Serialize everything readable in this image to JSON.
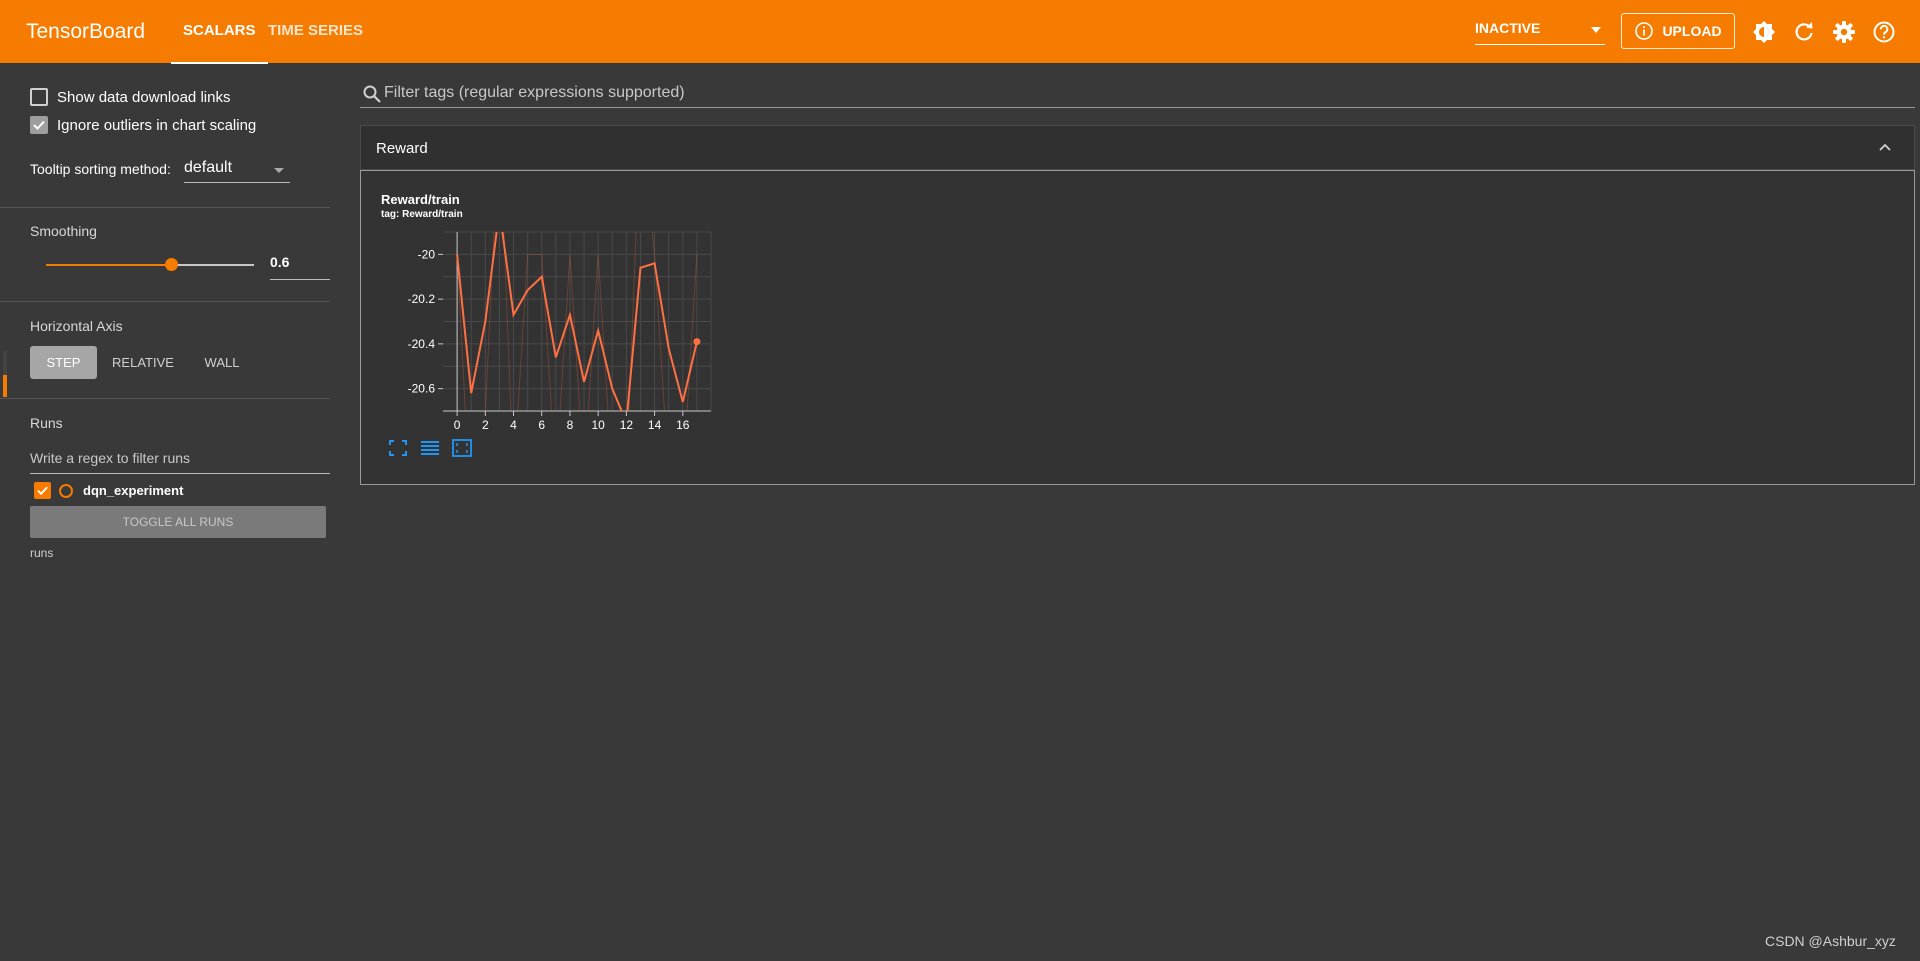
{
  "header": {
    "brand": "TensorBoard",
    "tabs": [
      {
        "label": "SCALARS"
      },
      {
        "label": "TIME SERIES"
      }
    ],
    "status": "INACTIVE",
    "upload_label": "UPLOAD",
    "accent_color": "#f57c00"
  },
  "sidebar": {
    "show_download_links": {
      "label": "Show data download links",
      "checked": false
    },
    "ignore_outliers": {
      "label": "Ignore outliers in chart scaling",
      "checked": true
    },
    "tooltip_sorting": {
      "label": "Tooltip sorting method:",
      "value": "default"
    },
    "smoothing": {
      "title": "Smoothing",
      "value": "0.6"
    },
    "horizontal_axis": {
      "title": "Horizontal Axis",
      "options": [
        "STEP",
        "RELATIVE",
        "WALL"
      ],
      "selected": "STEP"
    },
    "runs": {
      "title": "Runs",
      "filter_placeholder": "Write a regex to filter runs",
      "items": [
        {
          "name": "dqn_experiment",
          "checked": true
        }
      ],
      "toggle_label": "TOGGLE ALL RUNS",
      "footer": "runs"
    }
  },
  "main": {
    "filter_placeholder": "Filter tags (regular expressions supported)",
    "group": {
      "title": "Reward",
      "card": {
        "title": "Reward/train",
        "tag": "tag: Reward/train"
      }
    }
  },
  "chart_data": {
    "type": "line",
    "x": [
      0,
      1,
      2,
      3,
      4,
      5,
      6,
      7,
      8,
      9,
      10,
      11,
      12,
      13,
      14,
      15,
      16,
      17
    ],
    "series": [
      {
        "name": "dqn_experiment",
        "color": "#ff7043",
        "values": [
          -20.0,
          -20.62,
          -20.3,
          -19.8,
          -20.27,
          -20.16,
          -20.1,
          -20.46,
          -20.27,
          -20.57,
          -20.34,
          -20.6,
          -20.75,
          -20.06,
          -20.04,
          -20.42,
          -20.66,
          -20.39
        ]
      }
    ],
    "xticks": [
      "0",
      "2",
      "4",
      "6",
      "8",
      "10",
      "12",
      "14",
      "16"
    ],
    "yticks": [
      "-20",
      "-20.2",
      "-20.4",
      "-20.6"
    ],
    "xlim": [
      -1,
      18
    ],
    "ylim": [
      -20.7,
      -19.9
    ],
    "grid": true
  },
  "footer": {
    "watermark": "CSDN @Ashbur_xyz"
  }
}
